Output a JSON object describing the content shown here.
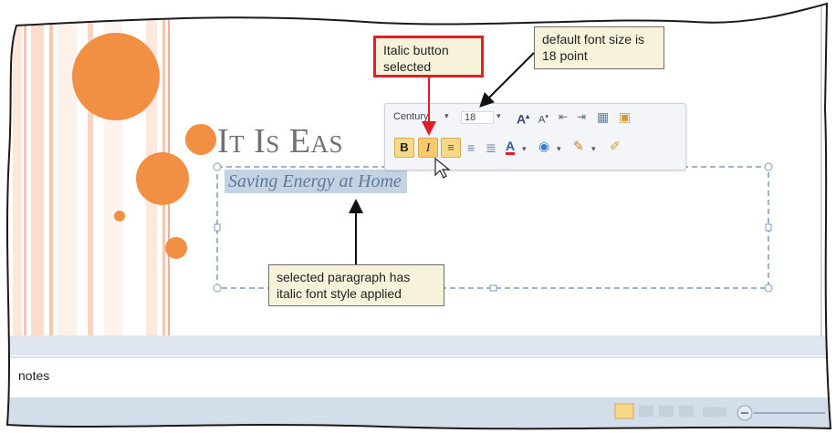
{
  "slide": {
    "title": "It Is Eas",
    "subtitle": "Saving Energy at Home"
  },
  "mini_toolbar": {
    "font_name": "Century",
    "font_size": "18",
    "bold_label": "B",
    "italic_label": "I"
  },
  "callouts": {
    "italic": "Italic button selected",
    "font_size": "default font size is 18 point",
    "paragraph": "selected paragraph has italic font style applied"
  },
  "notes": {
    "label": "notes"
  },
  "colors": {
    "accent_orange": "#f18f45",
    "stripe_peach": "#f6c5b4",
    "callout_red": "#e31e26",
    "selection_blue": "#c4d3e3"
  }
}
